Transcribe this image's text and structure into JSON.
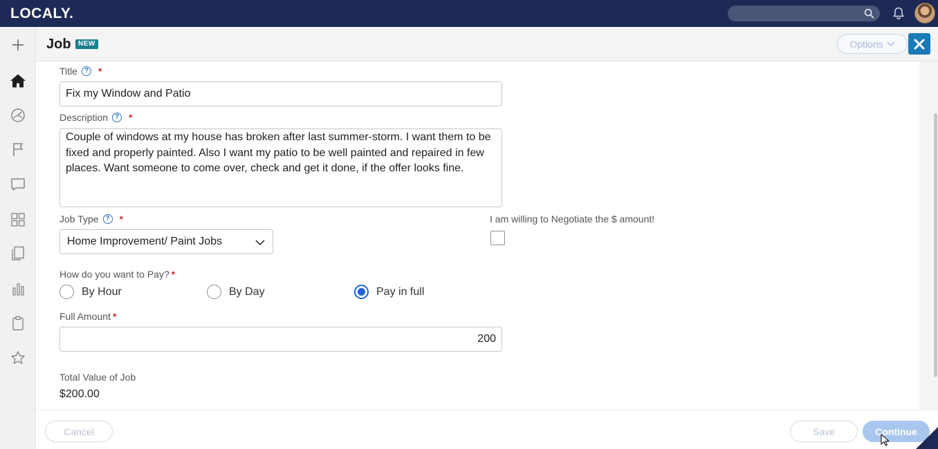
{
  "app": {
    "logo": "LOCALY.",
    "search_placeholder": ""
  },
  "header": {
    "title": "Job",
    "badge": "NEW",
    "options_label": "Options"
  },
  "form": {
    "title_label": "Title",
    "title_value": "Fix my Window and Patio",
    "description_label": "Description",
    "description_value": "Couple of windows at my house has broken after last summer-storm. I want them to be fixed and properly painted. Also I want my patio to be well painted and repaired in few places. Want someone to come over, check and get it done, if the offer looks fine.",
    "job_type_label": "Job Type",
    "job_type_value": "Home Improvement/ Paint Jobs",
    "negotiate_label": "I am willing to Negotiate the $ amount!",
    "negotiate_checked": false,
    "pay_label": "How do you want to Pay?",
    "pay_options": [
      "By Hour",
      "By Day",
      "Pay in full"
    ],
    "pay_selected": "Pay in full",
    "amount_label": "Full Amount",
    "amount_value": "200",
    "total_label": "Total Value of Job",
    "total_value": "$200.00"
  },
  "footer": {
    "cancel_label": "Cancel",
    "save_label": "Save",
    "continue_label": "Continue"
  },
  "sidebar": {
    "icons": [
      "plus-icon",
      "home-icon",
      "dashboard-icon",
      "flag-icon",
      "message-icon",
      "grid-icon",
      "documents-icon",
      "bar-chart-icon",
      "clipboard-icon",
      "star-icon"
    ]
  },
  "colors": {
    "topbar": "#1d2a55",
    "accent": "#1e64d6",
    "badge": "#1a7f8e",
    "required": "#d0312d"
  }
}
